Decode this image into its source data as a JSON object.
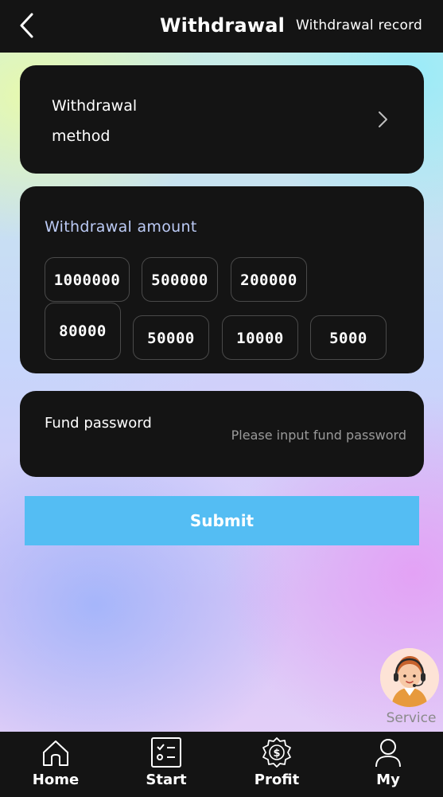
{
  "header": {
    "title": "Withdrawal",
    "record_link": "Withdrawal record",
    "back_icon": "chevron-left-icon"
  },
  "method": {
    "label": "Withdrawal method",
    "chevron_icon": "chevron-right-icon"
  },
  "amount": {
    "label": "Withdrawal amount",
    "options": [
      "1000000",
      "500000",
      "200000",
      "80000",
      "50000",
      "10000",
      "5000"
    ]
  },
  "password": {
    "label": "Fund password",
    "placeholder": "Please input fund password"
  },
  "submit": {
    "label": "Submit"
  },
  "service": {
    "label": "Service",
    "icon": "customer-service-avatar"
  },
  "nav": {
    "items": [
      {
        "label": "Home",
        "icon": "home-icon"
      },
      {
        "label": "Start",
        "icon": "task-list-icon"
      },
      {
        "label": "Profit",
        "icon": "dollar-badge-icon"
      },
      {
        "label": "My",
        "icon": "user-icon"
      }
    ]
  },
  "colors": {
    "header_bg": "#141414",
    "card_bg": "#141414",
    "accent": "#54bdf3",
    "amount_label": "#bccbf6"
  }
}
